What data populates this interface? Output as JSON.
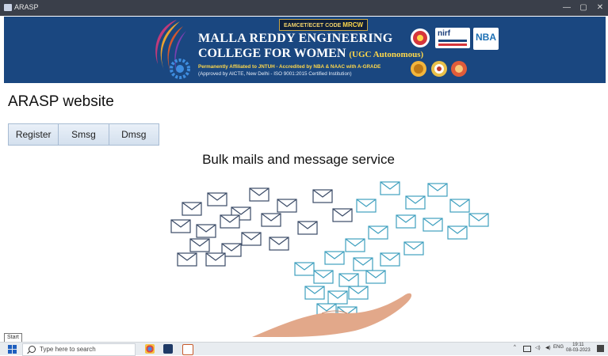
{
  "window": {
    "title": "ARASP",
    "minimize_glyph": "—",
    "maximize_glyph": "▢",
    "close_glyph": "✕",
    "bar_color": "#3a3f4a"
  },
  "banner": {
    "code_label": "EAMCET/ECET CODE",
    "code_value": "MRCW",
    "college_line1": "MALLA REDDY ENGINEERING",
    "college_line2": "COLLEGE FOR WOMEN",
    "autonomous": "(UGC Autonomous)",
    "affiliation": "Permanently Affiliated to JNTUH - Accredited by NBA & NAAC with A-GRADE",
    "approval": "(Approved by AICTE, New Delhi - ISO 9001:2015 Certified Institution)",
    "nirf_label": "nirf",
    "nba_label": "NBA",
    "bg_color": "#1a4780",
    "accent_color": "#ffd84a"
  },
  "page": {
    "title": "ARASP website",
    "subtitle": "Bulk mails and message service"
  },
  "nav": {
    "buttons": [
      "Register",
      "Smsg",
      "Dmsg"
    ]
  },
  "tooltip": {
    "text": "Start"
  },
  "taskbar": {
    "search_placeholder": "Type here to search",
    "tray_icons": [
      "chevron-up-icon",
      "network-icon",
      "volume-icon",
      "language-icon"
    ],
    "language": "ENG",
    "time": "19:11",
    "date": "08-03-2023",
    "apps": [
      "chrome-icon",
      "terminal-icon",
      "java-icon"
    ]
  }
}
